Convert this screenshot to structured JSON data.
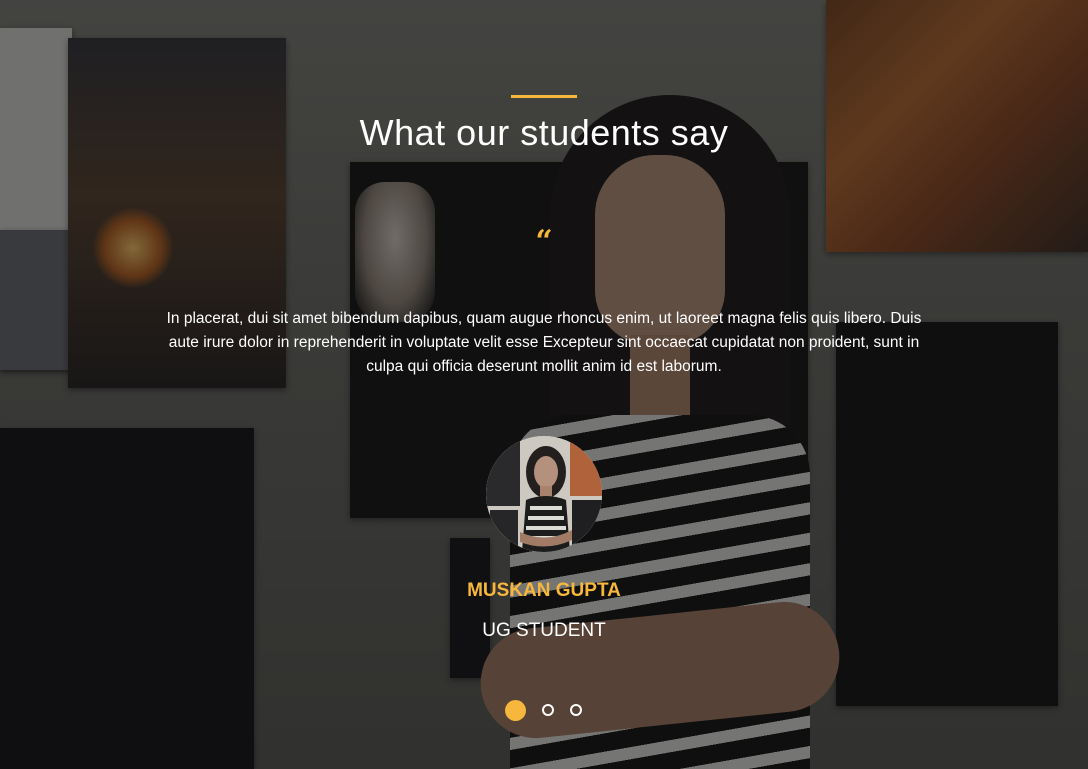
{
  "section": {
    "title": "What our students say",
    "accent_color": "#f6b73c"
  },
  "testimonial": {
    "quote_icon": "quote-open-icon",
    "text": "In placerat, dui sit amet bibendum dapibus, quam augue rhoncus enim, ut laoreet magna felis quis libero. Duis aute irure dolor in reprehenderit in voluptate velit esse  Excepteur sint occaecat cupidatat non proident, sunt in culpa qui officia deserunt mollit anim id est laborum.",
    "name": "MUSKAN GUPTA",
    "role": "UG STUDENT"
  },
  "carousel": {
    "slides": 3,
    "active_index": 0
  }
}
